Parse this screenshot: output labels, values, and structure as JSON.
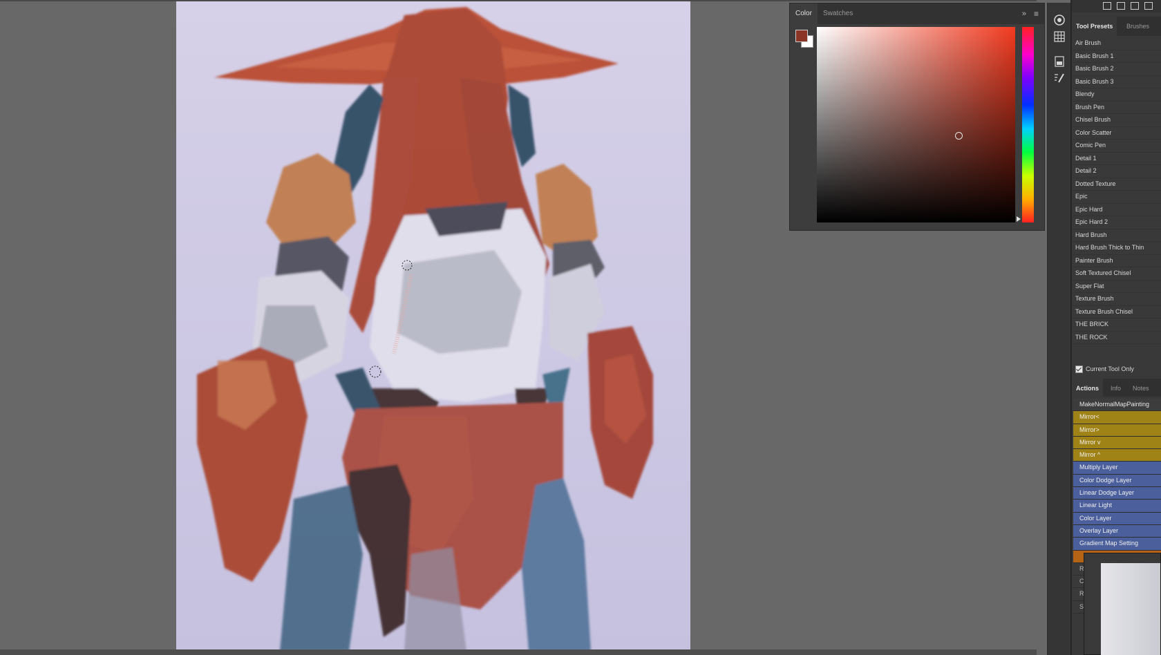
{
  "color_panel": {
    "tabs": [
      "Color",
      "Swatches"
    ],
    "collapse_glyph": "»",
    "menu_glyph": "≡",
    "foreground_color": "#8a3526",
    "background_color": "#ffffff",
    "picker_hue": "#f23a1f"
  },
  "icon_column": [
    "color-wheel-icon",
    "grid-icon",
    "layers-icon",
    "brush-settings-icon"
  ],
  "tool_presets": {
    "tabs": [
      "Tool Presets",
      "Brushes"
    ],
    "items": [
      "Air Brush",
      "Basic Brush 1",
      "Basic Brush 2",
      "Basic Brush 3",
      "Blendy",
      "Brush Pen",
      "Chisel Brush",
      "Color Scatter",
      "Comic Pen",
      "Detail 1",
      "Detail 2",
      "Dotted Texture",
      "Epic",
      "Epic Hard",
      "Epic Hard 2",
      "Hard Brush",
      "Hard Brush Thick to Thin",
      "Painter Brush",
      "Soft Textured Chisel",
      "Super Flat",
      "Texture Brush",
      "Texture Brush Chisel",
      "THE BRICK",
      "THE ROCK"
    ],
    "current_tool_only_label": "Current Tool Only",
    "current_tool_only_checked": true
  },
  "actions": {
    "tabs": [
      "Actions",
      "Info",
      "Notes"
    ],
    "items": [
      {
        "label": "MakeNormalMapPainting",
        "color": "plain"
      },
      {
        "label": "Mirror<",
        "color": "gold"
      },
      {
        "label": "Mirror>",
        "color": "gold"
      },
      {
        "label": "Mirror v",
        "color": "gold"
      },
      {
        "label": "Mirror ^",
        "color": "gold"
      },
      {
        "label": "Multiply Layer",
        "color": "blue"
      },
      {
        "label": "Color Dodge Layer",
        "color": "blue"
      },
      {
        "label": "Linear Dodge Layer",
        "color": "blue"
      },
      {
        "label": "Linear Light",
        "color": "blue"
      },
      {
        "label": "Color Layer",
        "color": "blue"
      },
      {
        "label": "Overlay Layer",
        "color": "blue"
      },
      {
        "label": "Gradient Map Setting",
        "color": "blue"
      },
      {
        "label": "",
        "color": "orange"
      },
      {
        "label": "R",
        "color": "dark"
      },
      {
        "label": "C",
        "color": "dark"
      },
      {
        "label": "R",
        "color": "dark"
      },
      {
        "label": "S",
        "color": "dark"
      }
    ]
  }
}
